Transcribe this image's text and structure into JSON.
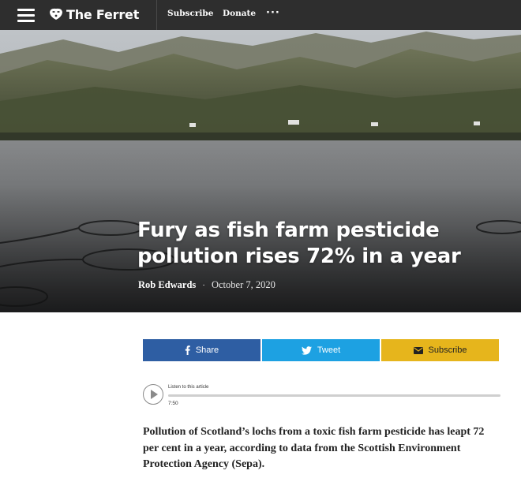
{
  "nav": {
    "brand": "The Ferret",
    "subscribe": "Subscribe",
    "donate": "Donate",
    "more": "···"
  },
  "article": {
    "title": "Fury as fish farm pesticide pollution rises 72% in a year",
    "author": "Rob Edwards",
    "separator": "·",
    "date": "October 7, 2020",
    "lead": "Pollution of Scotland’s lochs from a toxic fish farm pesticide has leapt 72 per cent in a year, according to data from the Scottish Environment Protection Agency (Sepa)."
  },
  "share": {
    "share_label": "Share",
    "tweet_label": "Tweet",
    "subscribe_label": "Subscribe"
  },
  "audio": {
    "label": "Listen to this article",
    "duration": "7:50",
    "progress": 0
  },
  "colors": {
    "topbar": "#2e2e2e",
    "facebook": "#2e5ea3",
    "twitter": "#1da1e2",
    "subscribe": "#e6b51c"
  },
  "icons": {
    "menu": "hamburger-icon",
    "logo": "ferret-logo-icon",
    "share": "facebook-icon",
    "tweet": "twitter-bird-icon",
    "subscribe": "envelope-icon",
    "play": "play-icon"
  }
}
